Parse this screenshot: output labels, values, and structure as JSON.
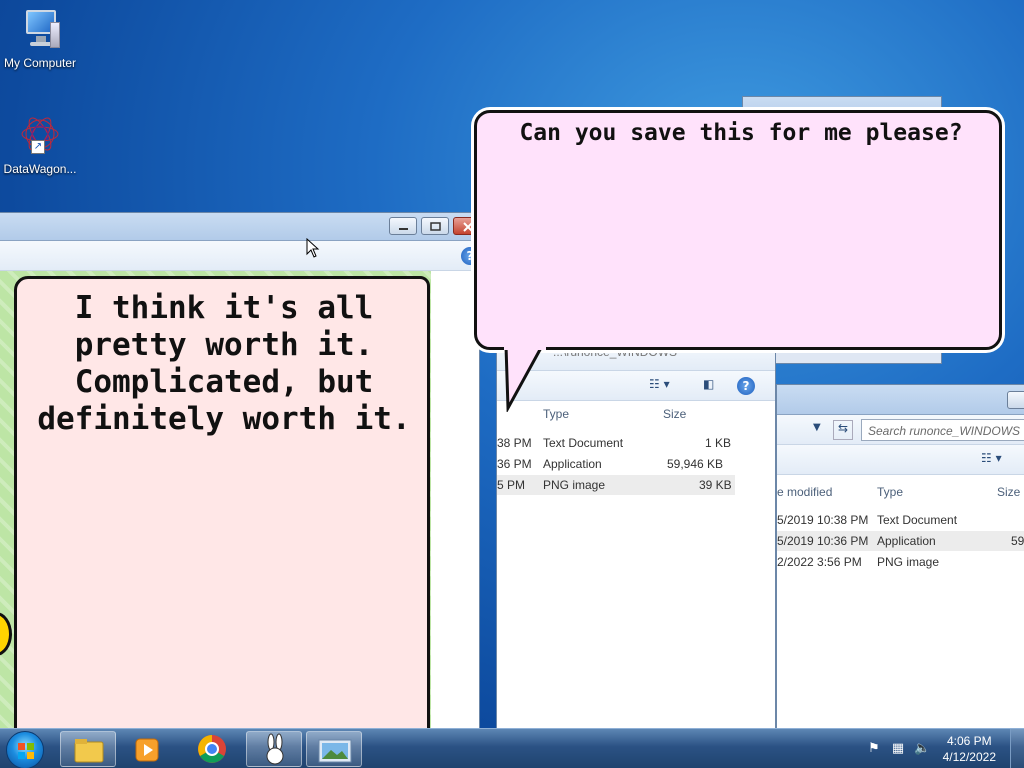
{
  "desktop": {
    "icons": [
      {
        "label": "My Computer",
        "icon": "computer-icon"
      },
      {
        "label": "DataWagon...",
        "icon": "spirograph-icon"
      }
    ]
  },
  "game": {
    "left_bubble_text": "I think it's all pretty worth it. Complicated, but definitely worth it.",
    "top_bubble_text": "Can you save this for me please?"
  },
  "explorer_mid": {
    "breadcrumb": "...\\runonce_WINDOWS",
    "columns": [
      "Type",
      "Size"
    ],
    "rows": [
      {
        "date": "38 PM",
        "type": "Text Document",
        "size": "1 KB"
      },
      {
        "date": "36 PM",
        "type": "Application",
        "size": "59,946 KB"
      },
      {
        "date": "5 PM",
        "type": "PNG image",
        "size": "39 KB"
      }
    ]
  },
  "explorer_right": {
    "search_placeholder": "Search runonce_WINDOWS",
    "columns": [
      "e modified",
      "Type",
      "Size"
    ],
    "rows": [
      {
        "date": "5/2019 10:38 PM",
        "type": "Text Document",
        "size": ""
      },
      {
        "date": "5/2019 10:36 PM",
        "type": "Application",
        "size": "59"
      },
      {
        "date": "2/2022 3:56 PM",
        "type": "PNG image",
        "size": ""
      }
    ]
  },
  "taskbar": {
    "clock_time": "4:06 PM",
    "clock_date": "4/12/2022"
  },
  "colors": {
    "desktop": "#1e6cc4",
    "bubble_left": "#ffe7e7",
    "bubble_top": "#ffe2fb",
    "game_bg": "#bde5a5"
  }
}
